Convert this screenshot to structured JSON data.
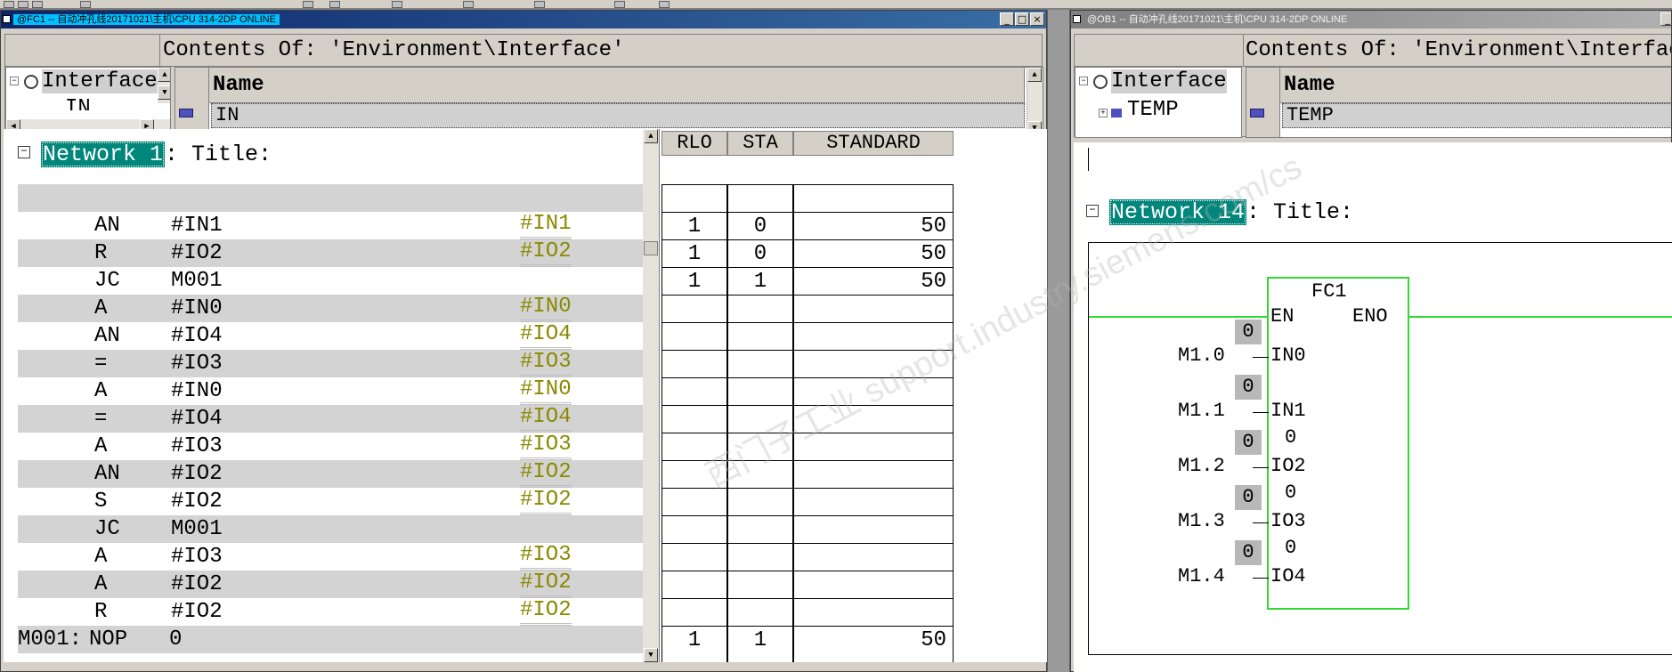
{
  "left_window": {
    "title": "@FC1 -- 自动冲孔线20171021\\主机\\CPU 314-2DP  ONLINE",
    "contents_of": "Contents Of: 'Environment\\Interface'",
    "tree": [
      "Interface",
      "IN"
    ],
    "grid_header": "Name",
    "grid_row": "IN",
    "network_number": "Network 1",
    "network_suffix": ": Title:",
    "code_rows": [
      {
        "label": "",
        "op": "AN",
        "arg": "#IN1",
        "sym": "#IN1"
      },
      {
        "label": "",
        "op": "R",
        "arg": "#IO2",
        "sym": "#IO2"
      },
      {
        "label": "",
        "op": "JC",
        "arg": "M001",
        "sym": ""
      },
      {
        "label": "",
        "op": "A",
        "arg": "#IN0",
        "sym": "#IN0"
      },
      {
        "label": "",
        "op": "AN",
        "arg": "#IO4",
        "sym": "#IO4"
      },
      {
        "label": "",
        "op": "=",
        "arg": "#IO3",
        "sym": "#IO3"
      },
      {
        "label": "",
        "op": "A",
        "arg": "#IN0",
        "sym": "#IN0"
      },
      {
        "label": "",
        "op": "=",
        "arg": "#IO4",
        "sym": "#IO4"
      },
      {
        "label": "",
        "op": "A",
        "arg": "#IO3",
        "sym": "#IO3"
      },
      {
        "label": "",
        "op": "AN",
        "arg": "#IO2",
        "sym": "#IO2"
      },
      {
        "label": "",
        "op": "S",
        "arg": "#IO2",
        "sym": "#IO2"
      },
      {
        "label": "",
        "op": "JC",
        "arg": "M001",
        "sym": ""
      },
      {
        "label": "",
        "op": "A",
        "arg": "#IO3",
        "sym": "#IO3"
      },
      {
        "label": "",
        "op": "A",
        "arg": "#IO2",
        "sym": "#IO2"
      },
      {
        "label": "",
        "op": "R",
        "arg": "#IO2",
        "sym": "#IO2"
      },
      {
        "label": "M001:",
        "op": "NOP",
        "arg": "0",
        "sym": ""
      }
    ],
    "status_headers": [
      "RLO",
      "STA",
      "STANDARD"
    ],
    "status_rows": [
      {
        "rlo": "1",
        "sta": "0",
        "std": "50"
      },
      {
        "rlo": "1",
        "sta": "0",
        "std": "50"
      },
      {
        "rlo": "1",
        "sta": "1",
        "std": "50"
      },
      {
        "rlo": "",
        "sta": "",
        "std": ""
      },
      {
        "rlo": "",
        "sta": "",
        "std": ""
      },
      {
        "rlo": "",
        "sta": "",
        "std": ""
      },
      {
        "rlo": "",
        "sta": "",
        "std": ""
      },
      {
        "rlo": "",
        "sta": "",
        "std": ""
      },
      {
        "rlo": "",
        "sta": "",
        "std": ""
      },
      {
        "rlo": "",
        "sta": "",
        "std": ""
      },
      {
        "rlo": "",
        "sta": "",
        "std": ""
      },
      {
        "rlo": "",
        "sta": "",
        "std": ""
      },
      {
        "rlo": "",
        "sta": "",
        "std": ""
      },
      {
        "rlo": "",
        "sta": "",
        "std": ""
      },
      {
        "rlo": "",
        "sta": "",
        "std": ""
      },
      {
        "rlo": "1",
        "sta": "1",
        "std": "50"
      }
    ]
  },
  "right_window": {
    "title": "@OB1 -- 自动冲孔线20171021\\主机\\CPU 314-2DP  ONLINE",
    "contents_of": "Contents Of: 'Environment\\Interface",
    "tree": [
      "Interface",
      "TEMP"
    ],
    "grid_header": "Name",
    "grid_row": "TEMP",
    "network_number": "Network 14",
    "network_suffix": ": Title:",
    "block_name": "FC1",
    "en": "EN",
    "eno": "ENO",
    "inputs": [
      {
        "addr": "M1.0",
        "pin": "IN0",
        "value": "0"
      },
      {
        "addr": "M1.1",
        "pin": "IN1",
        "value": "0"
      },
      {
        "addr": "M1.2",
        "pin": "IO2",
        "value": "0",
        "out_value": "0"
      },
      {
        "addr": "M1.3",
        "pin": "IO3",
        "value": "0",
        "out_value": "0"
      },
      {
        "addr": "M1.4",
        "pin": "IO4",
        "value": "0",
        "out_value": "0"
      }
    ]
  },
  "watermark": "西门子工业 support.industry.siemens.com/cs"
}
